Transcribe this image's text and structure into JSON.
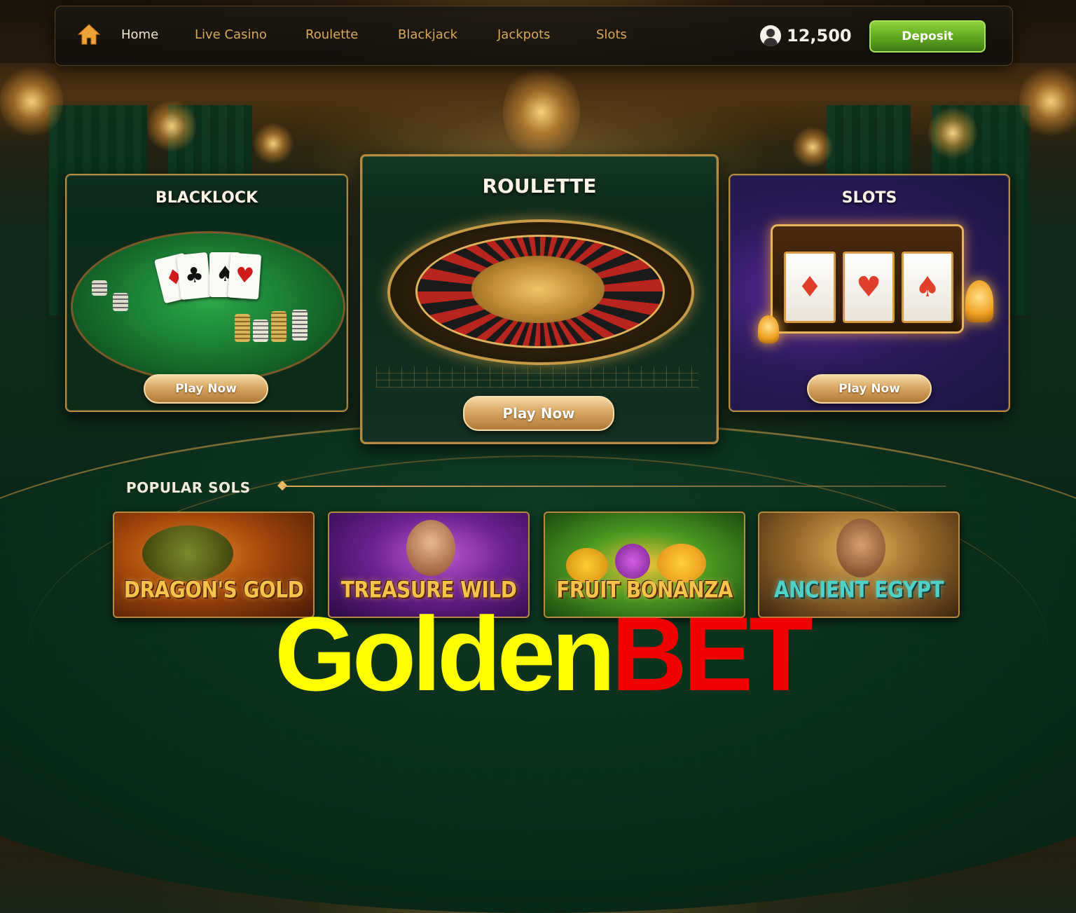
{
  "nav": {
    "items": [
      {
        "label": "Home",
        "active": true
      },
      {
        "label": "Live Casino"
      },
      {
        "label": "Roulette"
      },
      {
        "label": "Blackjack"
      },
      {
        "label": "Jackpots"
      },
      {
        "label": "Slots"
      }
    ],
    "balance": "12,500",
    "deposit_label": "Deposit"
  },
  "games": {
    "blackjack": {
      "title": "BLACKLOCK",
      "button": "Play Now"
    },
    "roulette": {
      "title": "ROULETTE",
      "button": "Play Now"
    },
    "slots": {
      "title": "SLOTS",
      "button": "Play Now"
    }
  },
  "popular": {
    "title": "POPULAR SOLS",
    "tiles": [
      {
        "name": "DRAGON'S GOLD"
      },
      {
        "name": "TREASURE WILD"
      },
      {
        "name": "FRUIT BONANZA"
      },
      {
        "name": "ANCIENT EGYPT"
      }
    ]
  },
  "brand": {
    "part1": "Golden",
    "part2": "BET"
  },
  "colors": {
    "accent_gold": "#d9a85a",
    "deposit_green": "#6fb52a",
    "brand_yellow": "#ffff00",
    "brand_red": "#f00000"
  }
}
